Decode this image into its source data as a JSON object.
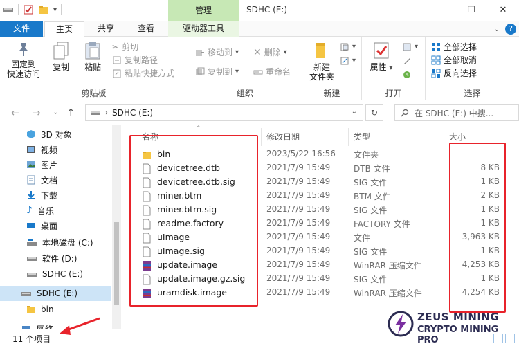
{
  "titlebar": {
    "manage_tab": "管理",
    "window_title": "SDHC (E:)",
    "minimize": "—",
    "maximize": "☐",
    "close": "✕"
  },
  "tabs": {
    "file": "文件",
    "home": "主页",
    "share": "共享",
    "view": "查看",
    "drive_tools": "驱动器工具",
    "expand": "⌄",
    "help": "?"
  },
  "ribbon": {
    "pin_line1": "固定到",
    "pin_line2": "快速访问",
    "copy": "复制",
    "paste": "粘贴",
    "cut": "剪切",
    "copy_path": "复制路径",
    "paste_shortcut": "粘贴快捷方式",
    "clipboard_label": "剪贴板",
    "move_to": "移动到",
    "copy_to": "复制到",
    "delete": "删除",
    "rename": "重命名",
    "organize_label": "组织",
    "new_folder_line1": "新建",
    "new_folder_line2": "文件夹",
    "new_label": "新建",
    "properties": "属性",
    "open_label": "打开",
    "select_all": "全部选择",
    "select_none": "全部取消",
    "invert_selection": "反向选择",
    "select_label": "选择"
  },
  "address": {
    "path": "SDHC (E:)",
    "search_placeholder": "在 SDHC (E:) 中搜..."
  },
  "nav": {
    "items": [
      {
        "label": "3D 对象"
      },
      {
        "label": "视频"
      },
      {
        "label": "图片"
      },
      {
        "label": "文档"
      },
      {
        "label": "下载"
      },
      {
        "label": "音乐"
      },
      {
        "label": "桌面"
      },
      {
        "label": "本地磁盘 (C:)"
      },
      {
        "label": "软件 (D:)"
      },
      {
        "label": "SDHC (E:)"
      },
      {
        "label": "SDHC (E:)"
      },
      {
        "label": "bin"
      },
      {
        "label": "网络"
      }
    ]
  },
  "columns": {
    "name": "名称",
    "date": "修改日期",
    "type": "类型",
    "size": "大小"
  },
  "files": [
    {
      "name": "bin",
      "date": "2023/5/22 16:56",
      "type": "文件夹",
      "size": "",
      "icon": "folder"
    },
    {
      "name": "devicetree.dtb",
      "date": "2021/7/9 15:49",
      "type": "DTB 文件",
      "size": "8 KB",
      "icon": "file"
    },
    {
      "name": "devicetree.dtb.sig",
      "date": "2021/7/9 15:49",
      "type": "SIG 文件",
      "size": "1 KB",
      "icon": "file"
    },
    {
      "name": "miner.btm",
      "date": "2021/7/9 15:49",
      "type": "BTM 文件",
      "size": "2 KB",
      "icon": "file"
    },
    {
      "name": "miner.btm.sig",
      "date": "2021/7/9 15:49",
      "type": "SIG 文件",
      "size": "1 KB",
      "icon": "file"
    },
    {
      "name": "readme.factory",
      "date": "2021/7/9 15:49",
      "type": "FACTORY 文件",
      "size": "1 KB",
      "icon": "file"
    },
    {
      "name": "uImage",
      "date": "2021/7/9 15:49",
      "type": "文件",
      "size": "3,963 KB",
      "icon": "file"
    },
    {
      "name": "uImage.sig",
      "date": "2021/7/9 15:49",
      "type": "SIG 文件",
      "size": "1 KB",
      "icon": "file"
    },
    {
      "name": "update.image",
      "date": "2021/7/9 15:49",
      "type": "WinRAR 压缩文件",
      "size": "4,253 KB",
      "icon": "rar"
    },
    {
      "name": "update.image.gz.sig",
      "date": "2021/7/9 15:49",
      "type": "SIG 文件",
      "size": "1 KB",
      "icon": "file"
    },
    {
      "name": "uramdisk.image",
      "date": "2021/7/9 15:49",
      "type": "WinRAR 压缩文件",
      "size": "4,254 KB",
      "icon": "rar"
    }
  ],
  "status": {
    "item_count": "11 个项目"
  },
  "watermark": {
    "line1": "ZEUS MINING",
    "line2": "CRYPTO MINING PRO"
  },
  "colors": {
    "accent": "#1979ca",
    "manage_tab": "#c7e8b5",
    "highlight_box": "#e8232b",
    "selection": "#cde4f7"
  }
}
